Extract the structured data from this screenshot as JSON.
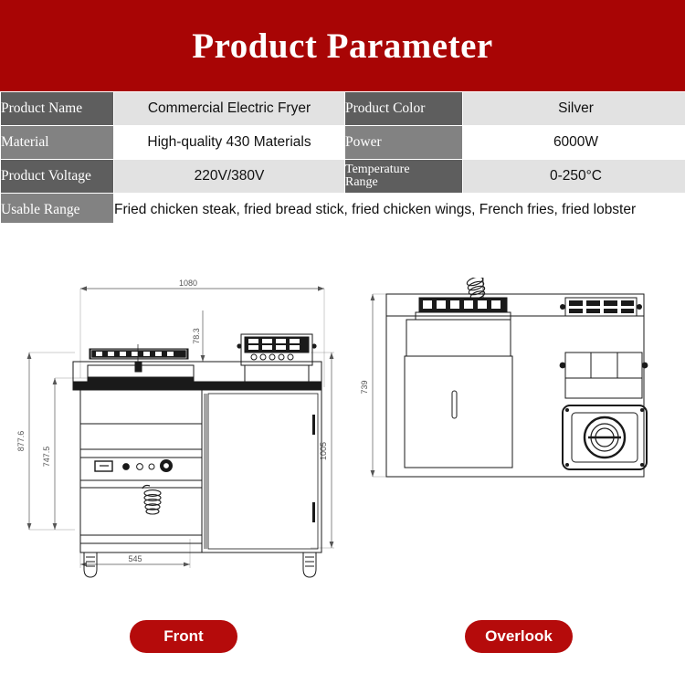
{
  "header": {
    "title": "Product Parameter",
    "bg_color": "#a80505"
  },
  "spec_table": {
    "rows": [
      {
        "left_label": "Product Name",
        "left_value": "Commercial Electric Fryer",
        "right_label": "Product Color",
        "right_value": "Silver"
      },
      {
        "left_label": "Material",
        "left_value": "High-quality 430 Materials",
        "right_label": "Power",
        "right_value": "6000W"
      },
      {
        "left_label": "Product Voltage",
        "left_value": "220V/380V",
        "right_label_line1": "Temperature",
        "right_label_line2": "Range",
        "right_value": "0-250°C"
      }
    ],
    "full_row": {
      "label": "Usable Range",
      "value": "Fried chicken steak, fried bread stick, fried chicken wings, French fries, fried lobster"
    },
    "label_color_dark": "#5e5e5e",
    "label_color_light": "#828282",
    "value_shade": "#e2e2e2"
  },
  "drawings": {
    "front": {
      "caption": "Front",
      "dimensions": {
        "overall_width": "1080",
        "top_offset": "78.3",
        "overall_height": "877.6",
        "work_height": "747.5",
        "total_height": "1005",
        "base_width": "545"
      }
    },
    "overlook": {
      "caption": "Overlook",
      "dimensions": {
        "depth": "739"
      }
    },
    "pill_color": "#b50b0b"
  }
}
